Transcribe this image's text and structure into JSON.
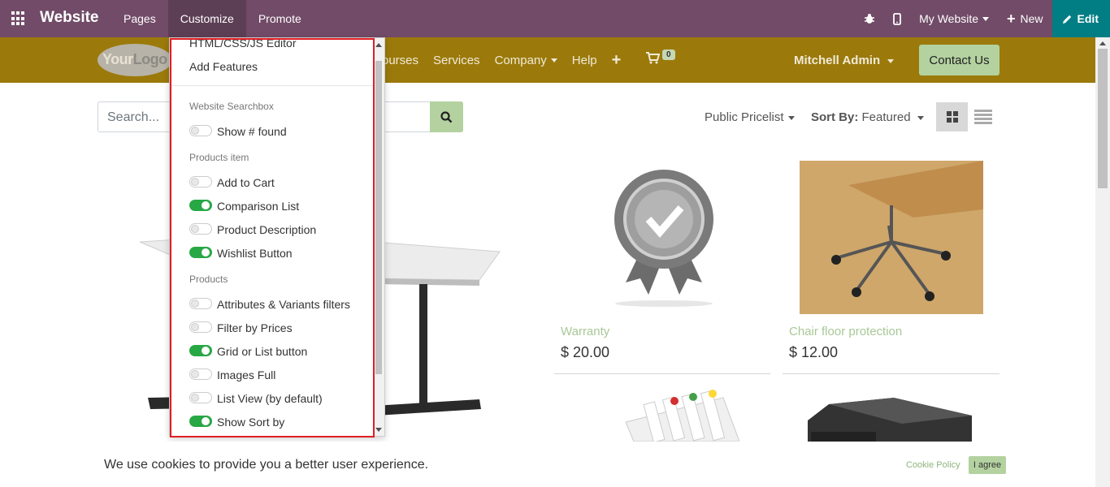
{
  "adminbar": {
    "brand": "Website",
    "menu": [
      {
        "label": "Pages"
      },
      {
        "label": "Customize"
      },
      {
        "label": "Promote"
      }
    ],
    "site_selector": "My Website",
    "new_label": "New",
    "edit_label": "Edit"
  },
  "header": {
    "logo_text_1": "Your",
    "logo_text_2": "Logo",
    "nav": [
      "ourses",
      "Services",
      "Company",
      "Help"
    ],
    "cart_count": "0",
    "user": "Mitchell Admin",
    "contact": "Contact Us"
  },
  "search": {
    "placeholder": "Search..."
  },
  "toolbar": {
    "pricelist": "Public Pricelist",
    "sort_label": "Sort By:",
    "sort_value": "Featured"
  },
  "products": [
    {
      "name": "Warranty",
      "price": "$ 20.00"
    },
    {
      "name": "Chair floor protection",
      "price": "$ 12.00"
    }
  ],
  "customize_menu": {
    "items_top": [
      "HTML/CSS/JS Editor",
      "Add Features"
    ],
    "sections": [
      {
        "title": "Website Searchbox",
        "options": [
          {
            "label": "Show # found",
            "on": false
          }
        ]
      },
      {
        "title": "Products item",
        "options": [
          {
            "label": "Add to Cart",
            "on": false
          },
          {
            "label": "Comparison List",
            "on": true
          },
          {
            "label": "Product Description",
            "on": false
          },
          {
            "label": "Wishlist Button",
            "on": true
          }
        ]
      },
      {
        "title": "Products",
        "options": [
          {
            "label": "Attributes & Variants filters",
            "on": false
          },
          {
            "label": "Filter by Prices",
            "on": false
          },
          {
            "label": "Grid or List button",
            "on": true
          },
          {
            "label": "Images Full",
            "on": false
          },
          {
            "label": "List View (by default)",
            "on": false
          },
          {
            "label": "Show Sort by",
            "on": true
          }
        ]
      }
    ]
  },
  "cookie": {
    "text": "We use cookies to provide you a better user experience.",
    "policy": "Cookie Policy",
    "agree": "I agree"
  },
  "colors": {
    "adminbar": "#714b67",
    "edit": "#017e84",
    "header": "#9b7a0b",
    "accent_green": "#b3d2a0",
    "toggle_on": "#28a745",
    "highlight": "#e01e25"
  }
}
